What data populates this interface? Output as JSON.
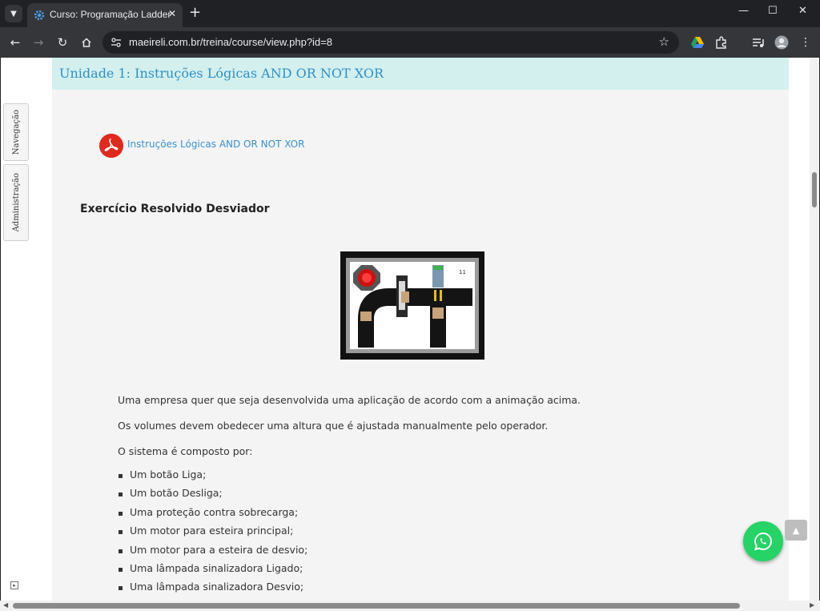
{
  "browser": {
    "tab_title": "Curso: Programação Ladder",
    "tab_close": "✕",
    "new_tab": "+",
    "url": "maeireli.com.br/treina/course/view.php?id=8",
    "win_minimize": "—",
    "win_maximize": "☐",
    "win_close": "✕"
  },
  "sidebar": {
    "tabs": [
      {
        "label": "Navegação"
      },
      {
        "label": "Administração"
      }
    ]
  },
  "unit": {
    "title": "Unidade 1: Instruções Lógicas AND OR NOT XOR"
  },
  "resource": {
    "label": "Instruções Lógicas AND OR NOT XOR",
    "icon": "pdf-icon"
  },
  "exercise": {
    "title": "Exercício Resolvido Desviador",
    "animation_counter": "11",
    "paragraphs": [
      "Uma empresa quer que seja desenvolvida uma aplicação de acordo com a animação acima.",
      "Os volumes devem obedecer uma altura que é ajustada manualmente pelo operador.",
      "O sistema é composto por:"
    ],
    "items": [
      "Um botão Liga;",
      "Um botão Desliga;",
      "Uma proteção contra sobrecarga;",
      "Um motor para esteira principal;",
      "Um motor para a esteira de desvio;",
      "Uma lâmpada sinalizadora Ligado;",
      "Uma lâmpada sinalizadora Desvio;"
    ]
  },
  "colors": {
    "header_bg": "#d3f0ee",
    "header_text": "#2f8fc5",
    "link": "#3a8fd3",
    "whatsapp": "#25d366",
    "pdf_red": "#e12a1e"
  }
}
